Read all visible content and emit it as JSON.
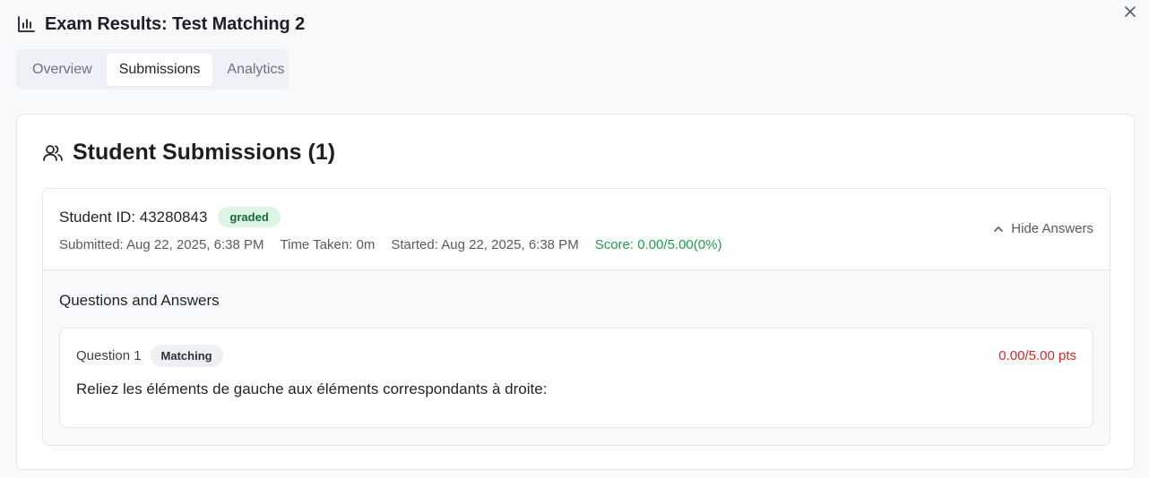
{
  "header": {
    "title": "Exam Results: Test Matching 2",
    "icon": "bar-chart-icon",
    "close_icon": "close-icon"
  },
  "tabs": [
    {
      "label": "Overview",
      "active": false
    },
    {
      "label": "Submissions",
      "active": true
    },
    {
      "label": "Analytics",
      "active": false
    }
  ],
  "submissions_section": {
    "icon": "users-icon",
    "title": "Student Submissions (1)"
  },
  "submission": {
    "student_id": "Student ID: 43280843",
    "status": "graded",
    "submitted": "Submitted: Aug 22, 2025, 6:38 PM",
    "time_taken": "Time Taken: 0m",
    "started": "Started: Aug 22, 2025, 6:38 PM",
    "score": "Score: 0.00/5.00(0%)",
    "toggle_label": "Hide Answers",
    "toggle_icon": "chevron-up-icon"
  },
  "answers": {
    "title": "Questions and Answers",
    "questions": [
      {
        "number": "Question 1",
        "type": "Matching",
        "points": "0.00/5.00 pts",
        "text": "Reliez les éléments de gauche aux éléments correspondants à droite:"
      }
    ]
  },
  "colors": {
    "score_green": "#1f9d4a",
    "points_red": "#dc2626",
    "graded_badge_bg": "#dcf5e4",
    "graded_badge_text": "#17683a"
  }
}
